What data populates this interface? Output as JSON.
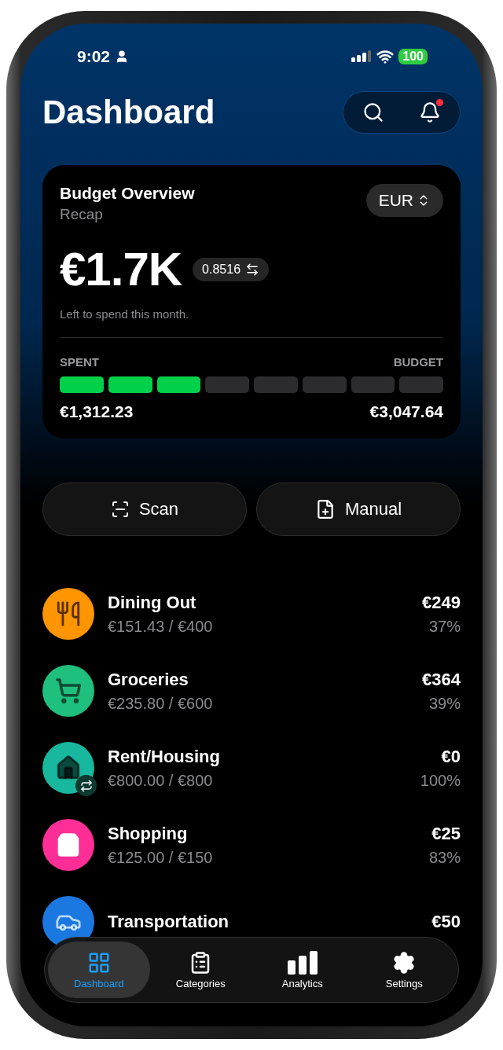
{
  "status_bar": {
    "time": "9:02",
    "battery": "100"
  },
  "header": {
    "title": "Dashboard",
    "has_unread": true
  },
  "budget_card": {
    "title": "Budget Overview",
    "subtitle": "Recap",
    "currency": "EUR",
    "amount": "€1.7K",
    "rate": "0.8516",
    "caption": "Left to spend this month.",
    "spent_label": "SPENT",
    "budget_label": "BUDGET",
    "level": 0.375,
    "spent": "€1,312.23",
    "budget": "€3,047.64"
  },
  "actions": [
    {
      "kind": "scan",
      "label": "Scan"
    },
    {
      "kind": "manual",
      "label": "Manual"
    }
  ],
  "categories": [
    {
      "kind": "dining",
      "color": "#ff9500",
      "name": "Dining Out",
      "progress": "€151.43 / €400",
      "left": "€249",
      "percent": "37%",
      "recurring": false
    },
    {
      "kind": "groceries",
      "color": "#1fbf7d",
      "name": "Groceries",
      "progress": "€235.80 / €600",
      "left": "€364",
      "percent": "39%",
      "recurring": false
    },
    {
      "kind": "housing",
      "color": "#17b89e",
      "name": "Rent/Housing",
      "progress": "€800.00 / €800",
      "left": "€0",
      "percent": "100%",
      "recurring": true
    },
    {
      "kind": "shopping",
      "color": "#ff2d96",
      "name": "Shopping",
      "progress": "€125.00 / €150",
      "left": "€25",
      "percent": "83%",
      "recurring": false
    },
    {
      "kind": "transport",
      "color": "#1a78e0",
      "name": "Transportation",
      "left": "€50",
      "recurring": false
    }
  ],
  "tabs": [
    {
      "kind": "dashboard",
      "label": "Dashboard",
      "selected": true
    },
    {
      "kind": "categories",
      "label": "Categories",
      "selected": false
    },
    {
      "kind": "analytics",
      "label": "Analytics",
      "selected": false
    },
    {
      "kind": "settings",
      "label": "Settings",
      "selected": false
    }
  ]
}
